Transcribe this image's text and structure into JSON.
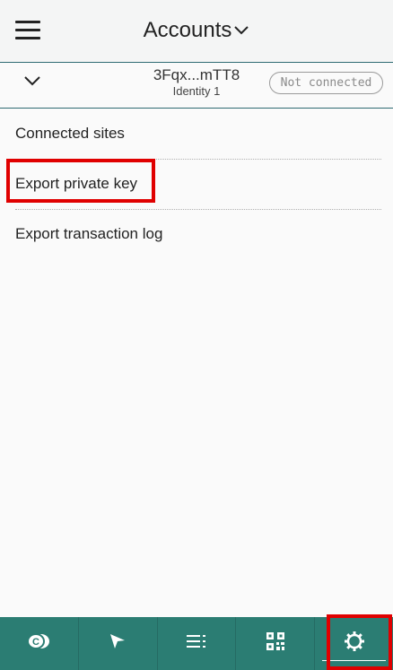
{
  "header": {
    "title": "Accounts",
    "menu_icon": "hamburger-menu-icon",
    "title_icon": "chevron-down-icon"
  },
  "account": {
    "address": "3Fqx...mTT8",
    "identity": "Identity 1",
    "status": "Not connected",
    "expand_icon": "chevron-down-icon"
  },
  "menu": {
    "items": [
      {
        "label": "Connected sites"
      },
      {
        "label": "Export private key"
      },
      {
        "label": "Export transaction log"
      }
    ]
  },
  "bottom_nav": {
    "items": [
      {
        "icon": "coins-icon"
      },
      {
        "icon": "send-icon"
      },
      {
        "icon": "transactions-list-icon"
      },
      {
        "icon": "qr-code-icon"
      },
      {
        "icon": "gear-icon",
        "active": true
      }
    ]
  },
  "colors": {
    "nav_bg": "#2b7d73",
    "divider": "#2f6b73",
    "highlight": "#e00000"
  }
}
